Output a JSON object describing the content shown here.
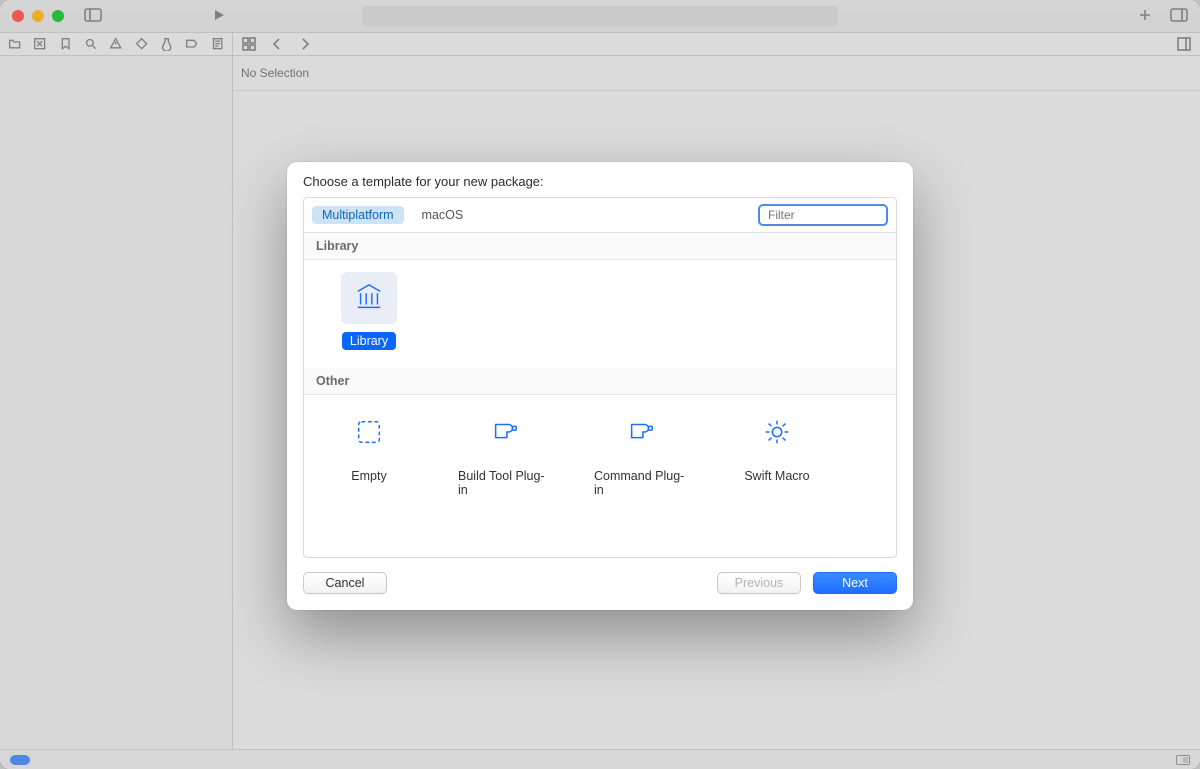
{
  "window": {
    "no_selection": "No Selection"
  },
  "modal": {
    "title": "Choose a template for your new package:",
    "scopes": {
      "multiplatform": "Multiplatform",
      "macos": "macOS"
    },
    "filter_placeholder": "Filter",
    "sections": {
      "library": {
        "title": "Library",
        "items": {
          "library": "Library"
        }
      },
      "other": {
        "title": "Other",
        "items": {
          "empty": "Empty",
          "build_tool": "Build Tool Plug-in",
          "command": "Command Plug-in",
          "swift_macro": "Swift Macro"
        }
      }
    },
    "buttons": {
      "cancel": "Cancel",
      "previous": "Previous",
      "next": "Next"
    }
  }
}
